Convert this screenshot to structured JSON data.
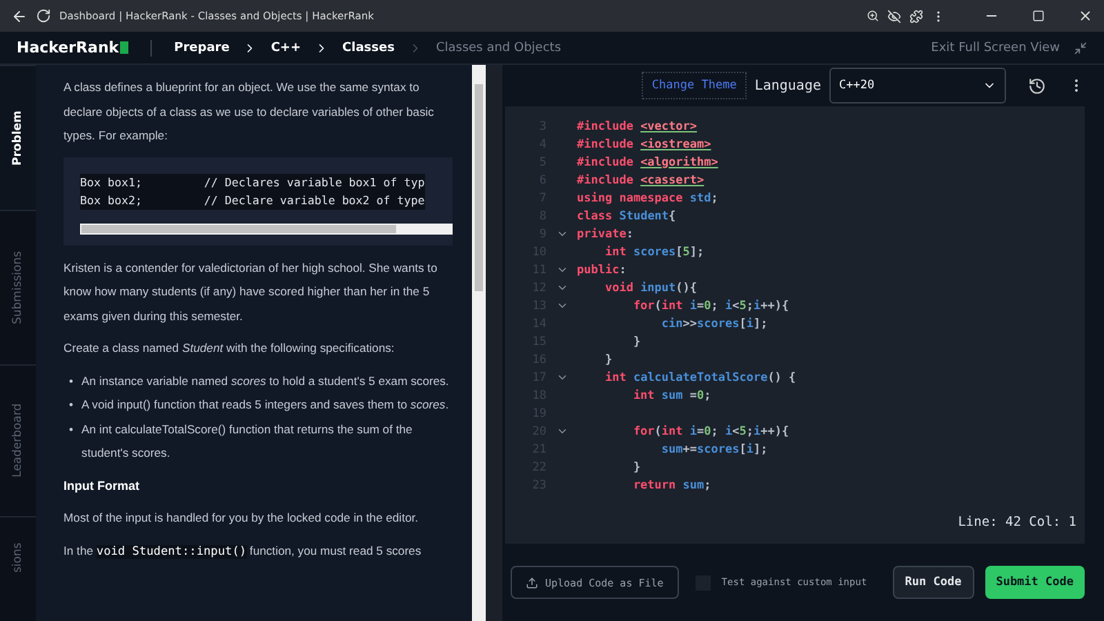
{
  "browser": {
    "title": "Dashboard | HackerRank - Classes and Objects | HackerRank"
  },
  "header": {
    "logo": "HackerRank",
    "breadcrumbs": [
      {
        "label": "Prepare",
        "current": false
      },
      {
        "label": "C++",
        "current": false
      },
      {
        "label": "Classes",
        "current": false
      },
      {
        "label": "Classes and Objects",
        "current": true
      }
    ],
    "exit_label": "Exit Full Screen View"
  },
  "side_tabs": [
    {
      "label": "Problem",
      "selected": true
    },
    {
      "label": "Submissions",
      "selected": false
    },
    {
      "label": "Leaderboard",
      "selected": false
    },
    {
      "label": "sions",
      "selected": false
    }
  ],
  "problem": {
    "blocks": [
      {
        "kind": "para",
        "text": "A class defines a blueprint for an object. We use the same syntax to declare objects of a class as we use to declare variables of other basic types. For example:"
      },
      {
        "kind": "code",
        "lines": [
          "Box box1;         // Declares variable box1 of typ",
          "Box box2;         // Declare variable box2 of type"
        ]
      },
      {
        "kind": "para",
        "text": "Kristen is a contender for valedictorian of her high school. She wants to know how many students (if any) have scored higher than her in the 5 exams given during this semester."
      },
      {
        "kind": "para",
        "text": "Create a class named *Student* with the following specifications:"
      },
      {
        "kind": "list",
        "marker": "•",
        "items": [
          "An instance variable named *scores* to hold a student's 5 exam scores.",
          "A void input() function that reads 5 integers and saves them to *scores*.",
          "An int calculateTotalScore() function that returns the sum of the student's scores."
        ]
      },
      {
        "kind": "heading",
        "text": "Input Format"
      },
      {
        "kind": "para",
        "text": "Most of the input is handled for you by the locked code in the editor."
      },
      {
        "kind": "mixed",
        "parts": [
          {
            "kind": "text",
            "text": "In the "
          },
          {
            "kind": "code",
            "text": "void Student::input()"
          },
          {
            "kind": "text",
            "text": " function, you must read 5 scores"
          }
        ]
      }
    ]
  },
  "editor": {
    "theme_button": "Change Theme",
    "language_label": "Language",
    "language": "C++20",
    "lines": [
      {
        "number": "3",
        "fold": false,
        "tokens": [
          {
            "kind": "kw",
            "text": "#include "
          },
          {
            "kind": "header",
            "text": "<vector>"
          }
        ]
      },
      {
        "number": "4",
        "fold": false,
        "tokens": [
          {
            "kind": "kw",
            "text": "#include "
          },
          {
            "kind": "header",
            "text": "<iostream>"
          }
        ]
      },
      {
        "number": "5",
        "fold": false,
        "tokens": [
          {
            "kind": "kw",
            "text": "#include "
          },
          {
            "kind": "header",
            "text": "<algorithm>"
          }
        ]
      },
      {
        "number": "6",
        "fold": false,
        "tokens": [
          {
            "kind": "kw",
            "text": "#include "
          },
          {
            "kind": "header",
            "text": "<cassert>"
          }
        ]
      },
      {
        "number": "7",
        "fold": false,
        "tokens": [
          {
            "kind": "kw",
            "text": "using namespace "
          },
          {
            "kind": "id",
            "text": "std"
          },
          {
            "kind": "plain",
            "text": ";"
          }
        ]
      },
      {
        "number": "8",
        "fold": false,
        "tokens": [
          {
            "kind": "kw",
            "text": "class "
          },
          {
            "kind": "id",
            "text": "Student"
          },
          {
            "kind": "plain",
            "text": "{"
          }
        ]
      },
      {
        "number": "9",
        "fold": true,
        "tokens": [
          {
            "kind": "kw",
            "text": "private"
          },
          {
            "kind": "plain",
            "text": ":"
          }
        ]
      },
      {
        "number": "10",
        "fold": false,
        "tokens": [
          {
            "kind": "kw",
            "text": "    int "
          },
          {
            "kind": "id",
            "text": "scores"
          },
          {
            "kind": "plain",
            "text": "["
          },
          {
            "kind": "num",
            "text": "5"
          },
          {
            "kind": "plain",
            "text": "];"
          }
        ]
      },
      {
        "number": "11",
        "fold": true,
        "tokens": [
          {
            "kind": "kw",
            "text": "public"
          },
          {
            "kind": "plain",
            "text": ":"
          }
        ]
      },
      {
        "number": "12",
        "fold": true,
        "tokens": [
          {
            "kind": "kw",
            "text": "    void "
          },
          {
            "kind": "id",
            "text": "input"
          },
          {
            "kind": "plain",
            "text": "(){"
          }
        ]
      },
      {
        "number": "13",
        "fold": true,
        "tokens": [
          {
            "kind": "kw",
            "text": "        for"
          },
          {
            "kind": "plain",
            "text": "("
          },
          {
            "kind": "kw",
            "text": "int "
          },
          {
            "kind": "id",
            "text": "i"
          },
          {
            "kind": "plain",
            "text": "="
          },
          {
            "kind": "num",
            "text": "0"
          },
          {
            "kind": "plain",
            "text": "; "
          },
          {
            "kind": "id",
            "text": "i"
          },
          {
            "kind": "plain",
            "text": "<"
          },
          {
            "kind": "num",
            "text": "5"
          },
          {
            "kind": "plain",
            "text": ";"
          },
          {
            "kind": "id",
            "text": "i"
          },
          {
            "kind": "plain",
            "text": "++){"
          }
        ]
      },
      {
        "number": "14",
        "fold": false,
        "tokens": [
          {
            "kind": "id",
            "text": "            cin"
          },
          {
            "kind": "plain",
            "text": ">>"
          },
          {
            "kind": "id",
            "text": "scores"
          },
          {
            "kind": "plain",
            "text": "["
          },
          {
            "kind": "id",
            "text": "i"
          },
          {
            "kind": "plain",
            "text": "];"
          }
        ]
      },
      {
        "number": "15",
        "fold": false,
        "tokens": [
          {
            "kind": "plain",
            "text": "        }"
          }
        ]
      },
      {
        "number": "16",
        "fold": false,
        "tokens": [
          {
            "kind": "plain",
            "text": "    }"
          }
        ]
      },
      {
        "number": "17",
        "fold": true,
        "tokens": [
          {
            "kind": "kw",
            "text": "    int "
          },
          {
            "kind": "id",
            "text": "calculateTotalScore"
          },
          {
            "kind": "plain",
            "text": "() {"
          }
        ]
      },
      {
        "number": "18",
        "fold": false,
        "tokens": [
          {
            "kind": "kw",
            "text": "        int "
          },
          {
            "kind": "id",
            "text": "sum"
          },
          {
            "kind": "plain",
            "text": " ="
          },
          {
            "kind": "num",
            "text": "0"
          },
          {
            "kind": "plain",
            "text": ";"
          }
        ]
      },
      {
        "number": "19",
        "fold": false
      },
      {
        "number": "20",
        "fold": true,
        "tokens": [
          {
            "kind": "kw",
            "text": "        for"
          },
          {
            "kind": "plain",
            "text": "("
          },
          {
            "kind": "kw",
            "text": "int "
          },
          {
            "kind": "id",
            "text": "i"
          },
          {
            "kind": "plain",
            "text": "="
          },
          {
            "kind": "num",
            "text": "0"
          },
          {
            "kind": "plain",
            "text": "; "
          },
          {
            "kind": "id",
            "text": "i"
          },
          {
            "kind": "plain",
            "text": "<"
          },
          {
            "kind": "num",
            "text": "5"
          },
          {
            "kind": "plain",
            "text": ";"
          },
          {
            "kind": "id",
            "text": "i"
          },
          {
            "kind": "plain",
            "text": "++){"
          }
        ]
      },
      {
        "number": "21",
        "fold": false,
        "tokens": [
          {
            "kind": "id",
            "text": "            sum"
          },
          {
            "kind": "plain",
            "text": "+="
          },
          {
            "kind": "id",
            "text": "scores"
          },
          {
            "kind": "plain",
            "text": "["
          },
          {
            "kind": "id",
            "text": "i"
          },
          {
            "kind": "plain",
            "text": "];"
          }
        ]
      },
      {
        "number": "22",
        "fold": false,
        "tokens": [
          {
            "kind": "plain",
            "text": "        }"
          }
        ]
      },
      {
        "number": "23",
        "fold": false,
        "tokens": [
          {
            "kind": "kw",
            "text": "        return "
          },
          {
            "kind": "id",
            "text": "sum"
          },
          {
            "kind": "plain",
            "text": ";"
          }
        ]
      }
    ],
    "status": "Line: 42 Col: 1"
  },
  "actions": {
    "upload": "Upload Code as File",
    "custom_input": {
      "label": "Test against custom input",
      "checked": false
    },
    "run": "Run Code",
    "submit": "Submit Code"
  }
}
